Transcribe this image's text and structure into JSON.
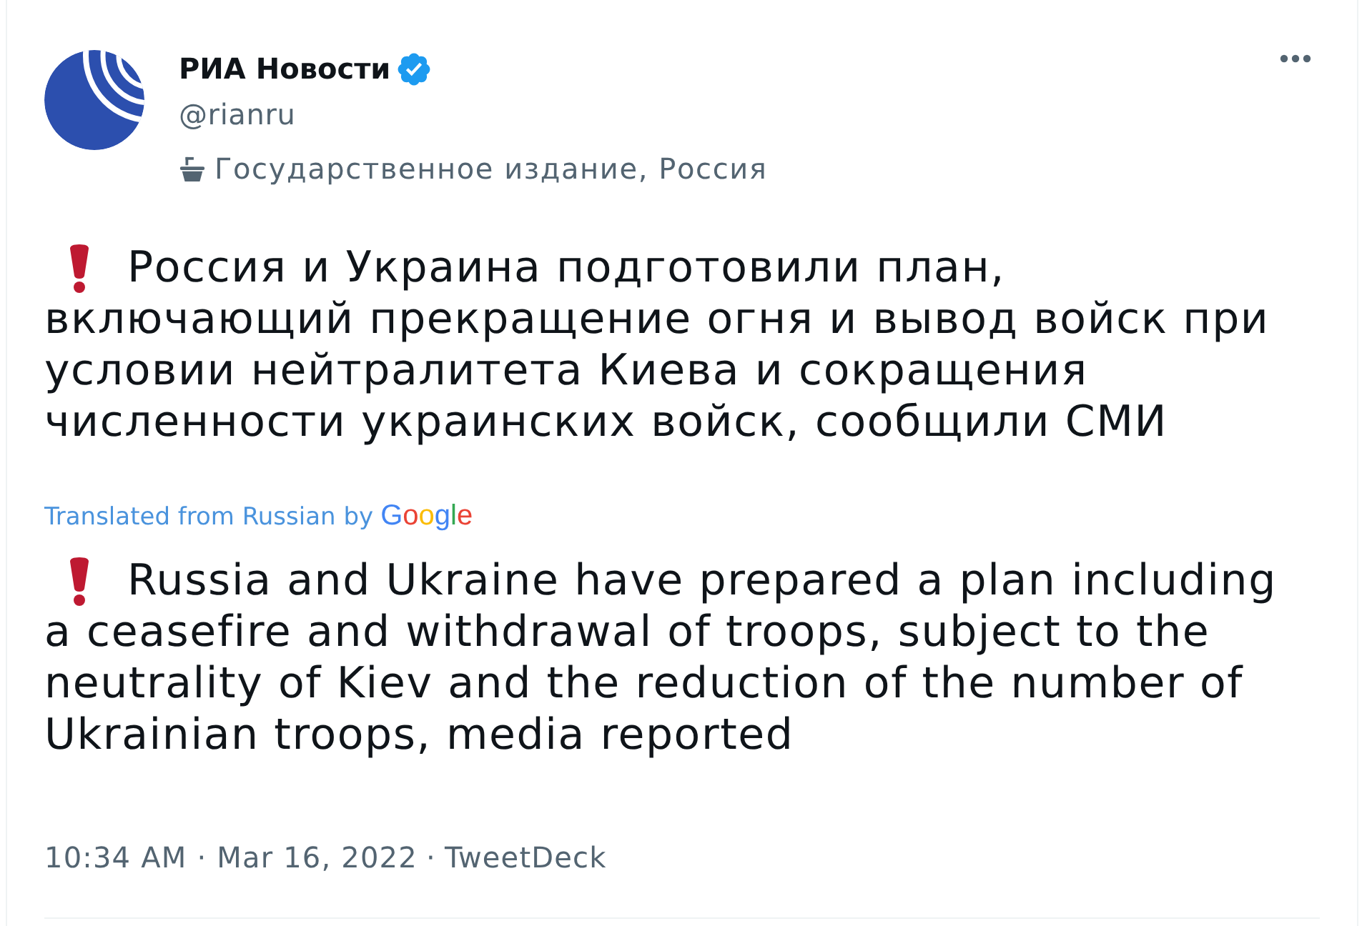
{
  "author": {
    "name": "РИА Новости",
    "verified": true,
    "handle": "@rianru",
    "label": "Государственное издание, Россия"
  },
  "tweet": {
    "lines": [
      "Россия и Украина подготовили план,",
      "включающий прекращение огня и вывод войск при",
      "условии нейтралитета Киева и сокращения",
      "численности украинских войск, сообщили СМИ"
    ],
    "translation_note": "Translated from Russian by",
    "translation_provider": "Google",
    "translation_lines": [
      "Russia and Ukraine have prepared a plan including",
      "a ceasefire and withdrawal of troops, subject to the",
      "neutrality of Kiev and the reduction of the number of",
      "Ukrainian troops, media reported"
    ]
  },
  "footer": {
    "timestamp": "10:34 AM · Mar 16, 2022",
    "separator": "·",
    "source": "TweetDeck"
  }
}
